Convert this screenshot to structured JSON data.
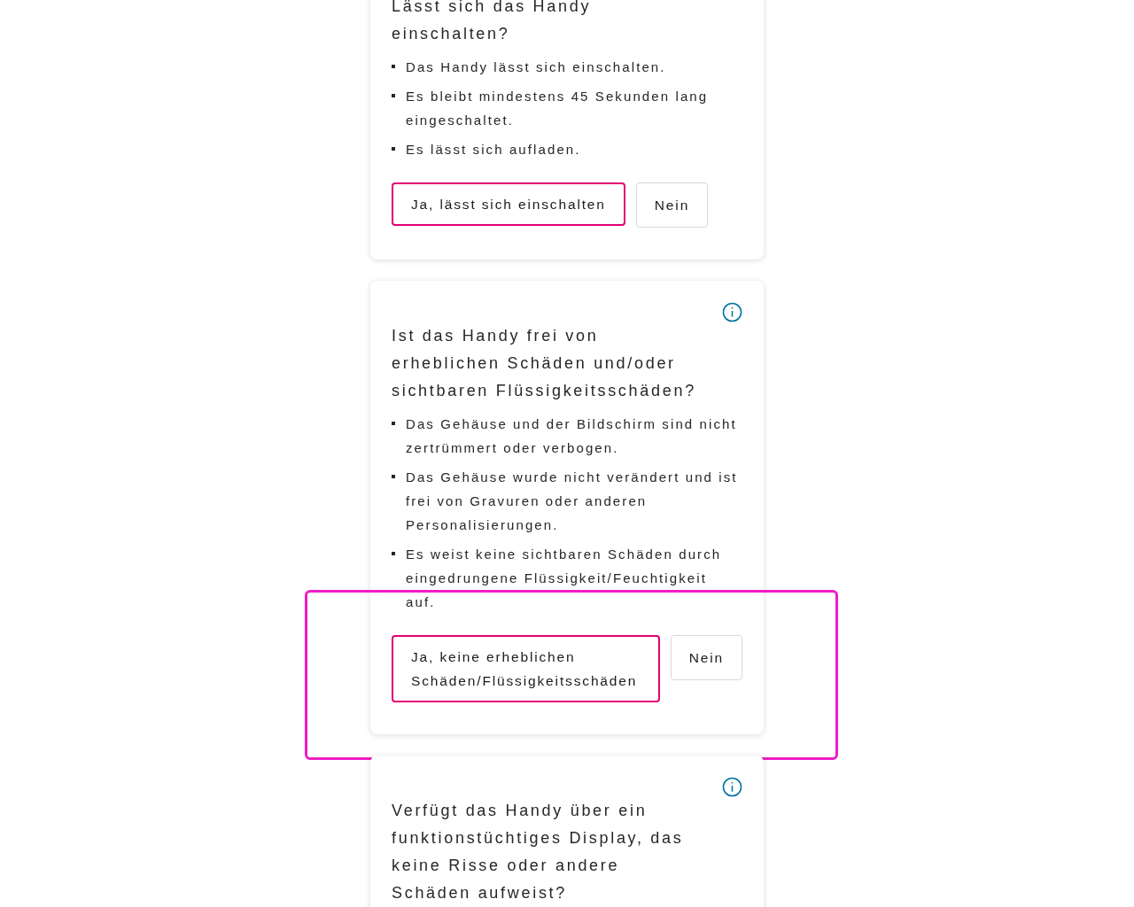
{
  "cards": [
    {
      "info": false,
      "highlighted": false,
      "title": "Lässt sich das Handy einschalten?",
      "bullets": [
        "Das Handy lässt sich einschalten.",
        "Es bleibt mindestens 45 Sekunden lang eingeschaltet.",
        "Es lässt sich aufladen."
      ],
      "buttons": [
        {
          "label": "Ja, lässt sich einschalten",
          "kind": "primary"
        },
        {
          "label": "Nein",
          "kind": "secondary"
        }
      ]
    },
    {
      "info": true,
      "highlighted": true,
      "title": "Ist das Handy frei von erheblichen Schäden und/oder sichtbaren Flüssigkeitsschäden?",
      "bullets": [
        "Das Gehäuse und der Bildschirm sind nicht zertrümmert oder verbogen.",
        "Das Gehäuse wurde nicht verändert und ist frei von Gravuren oder anderen Personalisierungen.",
        "Es weist keine sichtbaren Schäden durch eingedrungene Flüssigkeit/Feuchtigkeit auf."
      ],
      "buttons": [
        {
          "label": "Ja, keine erheblichen Schäden/Flüssigkeitsschäden",
          "kind": "primary"
        },
        {
          "label": "Nein",
          "kind": "secondary"
        }
      ]
    },
    {
      "info": true,
      "highlighted": false,
      "title": "Verfügt das Handy über ein funktionstüchtiges Display, das keine Risse oder andere Schäden aufweist?",
      "title_only": true
    }
  ]
}
